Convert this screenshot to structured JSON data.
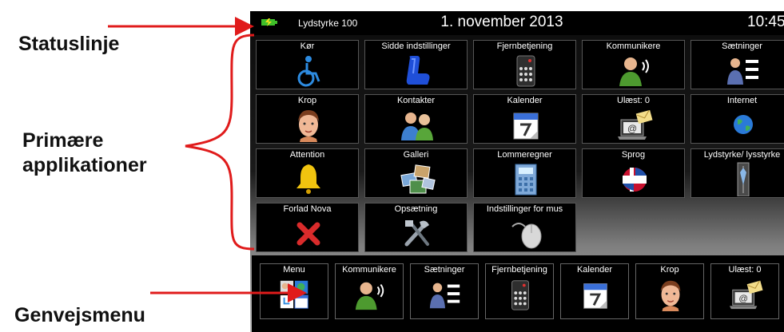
{
  "annotations": {
    "statusbar": "Statuslinje",
    "primary_line1": "Primære",
    "primary_line2": "applikationer",
    "shortcut": "Genvejsmenu"
  },
  "status": {
    "battery_icon": "battery-charging-icon",
    "volume": "Lydstyrke 100",
    "date": "1. november 2013",
    "time": "10:45"
  },
  "tiles": [
    {
      "label": "Kør",
      "icon": "wheelchair-icon"
    },
    {
      "label": "Sidde indstillinger",
      "icon": "seat-icon"
    },
    {
      "label": "Fjernbetjening",
      "icon": "remote-control-icon"
    },
    {
      "label": "Kommunikere",
      "icon": "speaking-person-icon"
    },
    {
      "label": "Sætninger",
      "icon": "person-list-icon"
    },
    {
      "label": "Krop",
      "icon": "face-icon"
    },
    {
      "label": "Kontakter",
      "icon": "contacts-icon"
    },
    {
      "label": "Kalender",
      "icon": "calendar-icon"
    },
    {
      "label": "Ulæst: 0",
      "icon": "email-laptop-icon"
    },
    {
      "label": "Internet",
      "icon": "globe-icon"
    },
    {
      "label": "Attention",
      "icon": "bell-icon"
    },
    {
      "label": "Galleri",
      "icon": "gallery-icon"
    },
    {
      "label": "Lommeregner",
      "icon": "calculator-icon"
    },
    {
      "label": "Sprog",
      "icon": "flags-globe-icon"
    },
    {
      "label": "Lydstyrke/ lysstyrke",
      "icon": "volume-slider-icon"
    },
    {
      "label": "Forlad Nova",
      "icon": "exit-x-icon"
    },
    {
      "label": "Opsætning",
      "icon": "tools-icon"
    },
    {
      "label": "Indstillinger for mus",
      "icon": "mouse-icon"
    }
  ],
  "shortcut_menu": [
    {
      "label": "Menu",
      "icon": "menu-grid-icon"
    },
    {
      "label": "Kommunikere",
      "icon": "speaking-person-icon"
    },
    {
      "label": "Sætninger",
      "icon": "person-list-icon"
    },
    {
      "label": "Fjernbetjening",
      "icon": "remote-control-icon"
    },
    {
      "label": "Kalender",
      "icon": "calendar-icon"
    },
    {
      "label": "Krop",
      "icon": "face-icon"
    },
    {
      "label": "Ulæst: 0",
      "icon": "email-laptop-icon"
    }
  ],
  "colors": {
    "annotation_arrow": "#e01b1b",
    "tile_background": "#000000",
    "screen_gradient_bottom": "#bdbdbd"
  }
}
